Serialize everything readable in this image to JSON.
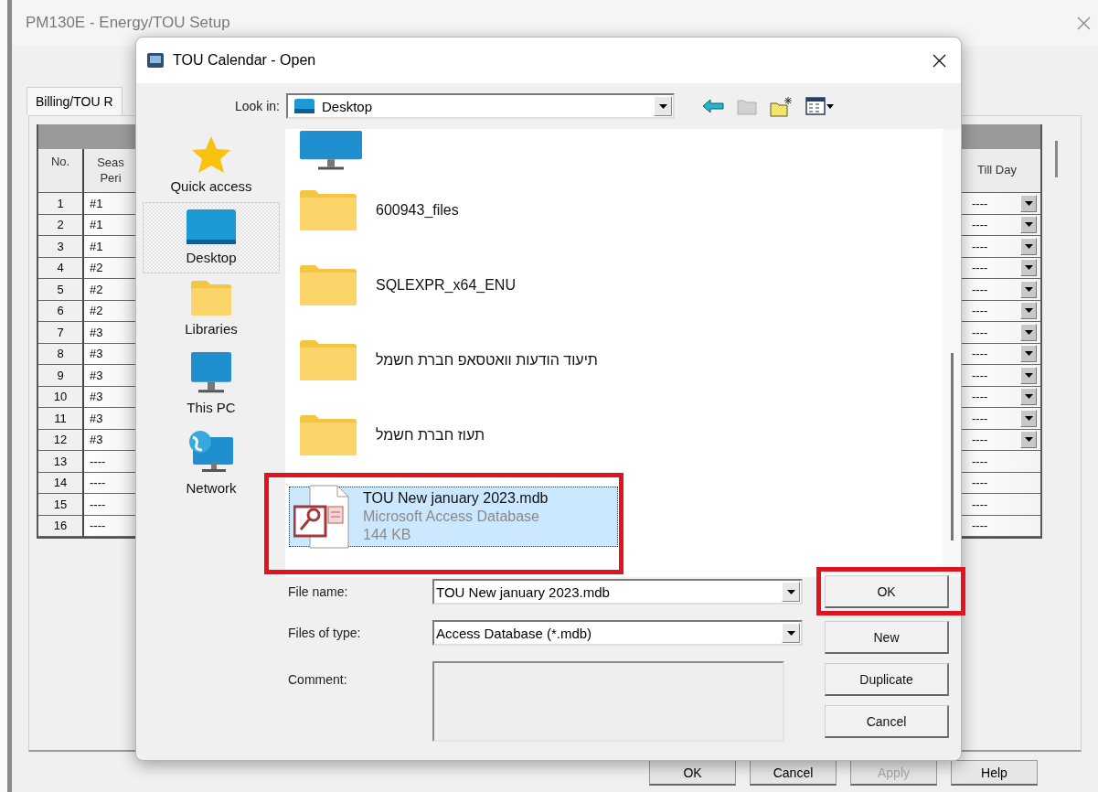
{
  "window": {
    "title": "PM130E - Energy/TOU Setup",
    "tabs": [
      {
        "label": "Billing/TOU R",
        "selected": true
      }
    ],
    "table": {
      "columns": [
        "No.",
        "Seas Peri",
        "Till Day"
      ],
      "rows": [
        {
          "no": "1",
          "season": "#1",
          "till_day": "----",
          "has_dropdown": true
        },
        {
          "no": "2",
          "season": "#1",
          "till_day": "----",
          "has_dropdown": true
        },
        {
          "no": "3",
          "season": "#1",
          "till_day": "----",
          "has_dropdown": true
        },
        {
          "no": "4",
          "season": "#2",
          "till_day": "----",
          "has_dropdown": true
        },
        {
          "no": "5",
          "season": "#2",
          "till_day": "----",
          "has_dropdown": true
        },
        {
          "no": "6",
          "season": "#2",
          "till_day": "----",
          "has_dropdown": true
        },
        {
          "no": "7",
          "season": "#3",
          "till_day": "----",
          "has_dropdown": true
        },
        {
          "no": "8",
          "season": "#3",
          "till_day": "----",
          "has_dropdown": true
        },
        {
          "no": "9",
          "season": "#3",
          "till_day": "----",
          "has_dropdown": true
        },
        {
          "no": "10",
          "season": "#3",
          "till_day": "----",
          "has_dropdown": true
        },
        {
          "no": "11",
          "season": "#3",
          "till_day": "----",
          "has_dropdown": true
        },
        {
          "no": "12",
          "season": "#3",
          "till_day": "----",
          "has_dropdown": true
        },
        {
          "no": "13",
          "season": "----",
          "till_day": "----",
          "has_dropdown": false
        },
        {
          "no": "14",
          "season": "----",
          "till_day": "----",
          "has_dropdown": false
        },
        {
          "no": "15",
          "season": "----",
          "till_day": "----",
          "has_dropdown": false
        },
        {
          "no": "16",
          "season": "----",
          "till_day": "----",
          "has_dropdown": false
        }
      ]
    },
    "buttons": [
      {
        "label": "OK",
        "disabled": false
      },
      {
        "label": "Cancel",
        "disabled": false
      },
      {
        "label": "Apply",
        "disabled": true
      },
      {
        "label": "Help",
        "disabled": false
      }
    ]
  },
  "dialog": {
    "title": "TOU Calendar - Open",
    "look_in": {
      "label": "Look in:",
      "value": "Desktop"
    },
    "places": [
      {
        "kind": "star",
        "label": "Quick access",
        "selected": false
      },
      {
        "kind": "desktop",
        "label": "Desktop",
        "selected": true
      },
      {
        "kind": "folder",
        "label": "Libraries",
        "selected": false
      },
      {
        "kind": "computer",
        "label": "This PC",
        "selected": false
      },
      {
        "kind": "network",
        "label": "Network",
        "selected": false
      }
    ],
    "files": [
      {
        "kind": "computer",
        "selected": false,
        "annotated": false
      },
      {
        "kind": "folder",
        "name": "600943_files",
        "selected": false,
        "annotated": false
      },
      {
        "kind": "folder",
        "name": "SQLEXPR_x64_ENU",
        "selected": false,
        "annotated": false
      },
      {
        "kind": "folder",
        "name": "תיעוד הודעות וואטסאפ חברת חשמל",
        "selected": false,
        "annotated": false
      },
      {
        "kind": "folder",
        "name": "תעוז חברת חשמל",
        "selected": false,
        "annotated": false
      },
      {
        "kind": "file",
        "name": "TOU New january 2023.mdb",
        "type": "Microsoft Access Database",
        "size": "144 KB",
        "selected": true,
        "annotated": true
      }
    ],
    "file_name": {
      "label": "File name:",
      "value": "TOU New january 2023.mdb"
    },
    "file_type": {
      "label": "Files of type:",
      "value": "Access Database (*.mdb)"
    },
    "comment": {
      "label": "Comment:"
    },
    "buttons": [
      {
        "label": "OK",
        "annotated": true
      },
      {
        "label": "New",
        "annotated": false
      },
      {
        "label": "Duplicate",
        "annotated": false
      },
      {
        "label": "Cancel",
        "annotated": false
      }
    ]
  }
}
